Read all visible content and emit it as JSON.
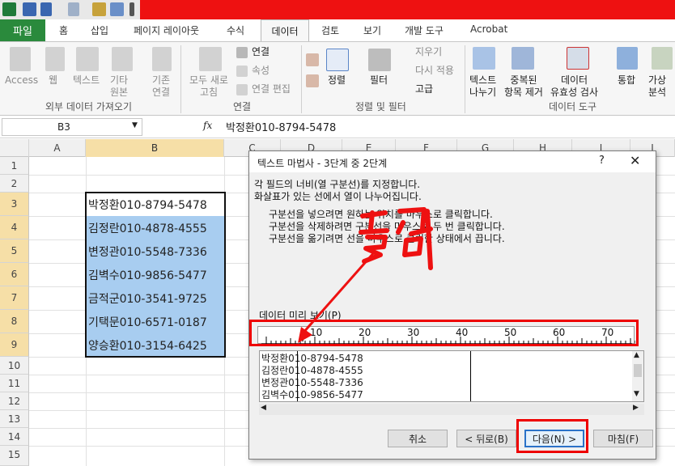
{
  "tabs": {
    "file": "파일",
    "home": "홈",
    "insert": "삽입",
    "page_layout": "페이지 레이아웃",
    "formulas": "수식",
    "data": "데이터",
    "review": "검토",
    "view": "보기",
    "developer": "개발 도구",
    "acrobat": "Acrobat"
  },
  "ribbon": {
    "access": "Access",
    "web": "웹",
    "text": "텍스트",
    "other_1": "기타",
    "other_2": "원본",
    "existing_1": "기존",
    "existing_2": "연결",
    "refresh_1": "모두 새로",
    "refresh_2": "고침",
    "connections": "연결",
    "properties": "속성",
    "edit_links": "연결 편집",
    "sort": "정렬",
    "filter": "필터",
    "clear": "지우기",
    "reapply": "다시 적용",
    "advanced": "고급",
    "text_to_cols_1": "텍스트",
    "text_to_cols_2": "나누기",
    "remove_dup_1": "중복된",
    "remove_dup_2": "항목 제거",
    "validation_1": "데이터",
    "validation_2": "유효성 검사",
    "consolidate": "통합",
    "whatif_1": "가상",
    "whatif_2": "분석",
    "group_external": "외부 데이터 가져오기",
    "group_connections": "연결",
    "group_sort_filter": "정렬 및 필터",
    "group_data_tools": "데이터 도구"
  },
  "formula_bar": {
    "name_box": "B3",
    "fx": "fx",
    "value": "박정환010-8794-5478"
  },
  "columns": [
    "A",
    "B",
    "C",
    "D",
    "E",
    "F",
    "G",
    "H",
    "I",
    "J"
  ],
  "rows": [
    "1",
    "2",
    "3",
    "4",
    "5",
    "6",
    "7",
    "8",
    "9",
    "10",
    "11",
    "12",
    "13",
    "14",
    "15"
  ],
  "cells": [
    "박정환010-8794-5478",
    "김정란010-4878-4555",
    "변정관010-5548-7336",
    "김벽수010-9856-5477",
    "금적군010-3541-9725",
    "기택문010-6571-0187",
    "양승환010-3154-6425"
  ],
  "dialog": {
    "title": "텍스트 마법사 - 3단계 중 2단계",
    "help": "?",
    "close": "✕",
    "intro_1": "각 필드의 너비(열 구분선)를 지정합니다.",
    "intro_2": "화살표가 있는 선에서 열이 나누어집니다.",
    "hint_1": "구분선을 넣으려면 원하는 위치를 마우스로 클릭합니다.",
    "hint_2": "구분선을 삭제하려면 구분선을 마우스로 두 번 클릭합니다.",
    "hint_3": "구분선을 옮기려면 선을 마우스로 클릭한 상태에서 끕니다.",
    "preview_label": "데이터 미리 보기(P)",
    "ruler_labels": [
      "10",
      "20",
      "30",
      "40",
      "50",
      "60",
      "70"
    ],
    "preview_rows": [
      "박정환010-8794-5478",
      "김정란010-4878-4555",
      "변정관010-5548-7336",
      "김벽수010-9856-5477"
    ],
    "btn_cancel": "취소",
    "btn_back": "< 뒤로(B)",
    "btn_next": "다음(N) >",
    "btn_finish": "마침(F)"
  },
  "annotation": {
    "handwritten": "클릭",
    "color": "#ee1111"
  }
}
